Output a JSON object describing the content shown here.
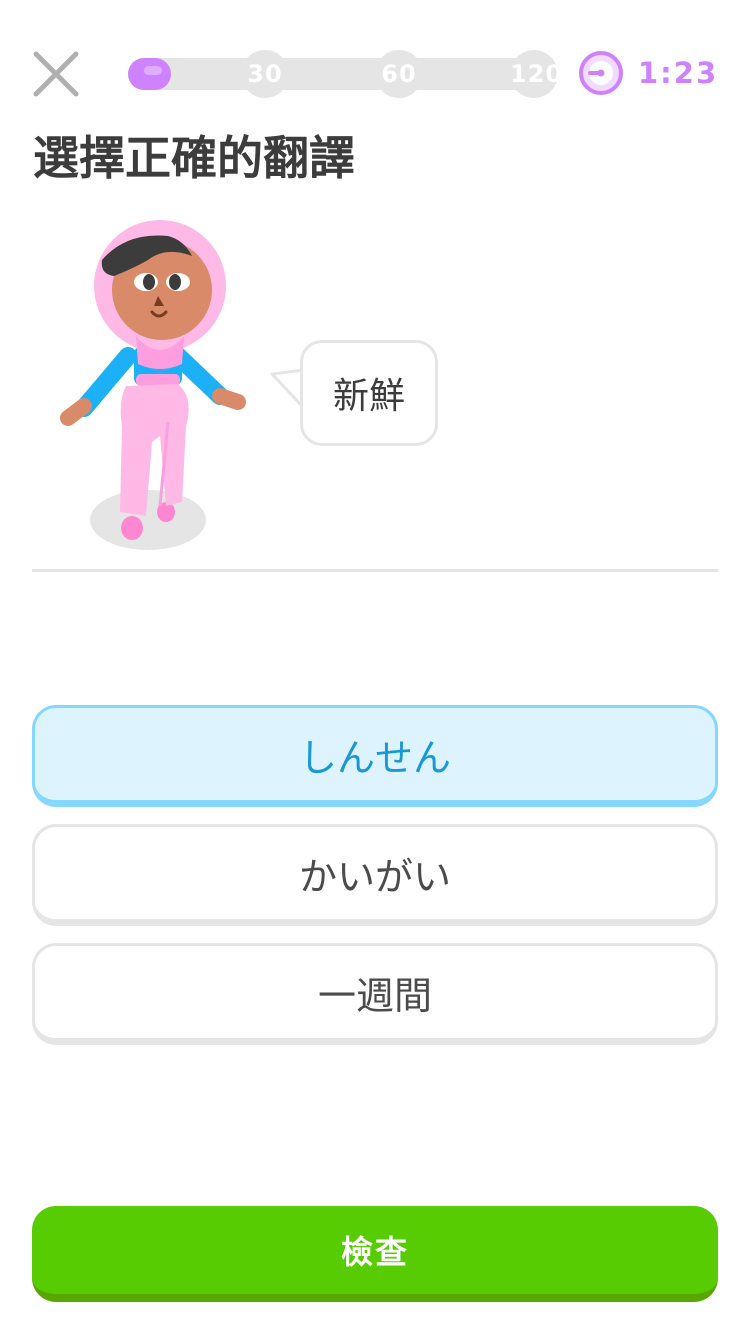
{
  "header": {
    "close_icon": "close-icon",
    "progress": {
      "fraction": 0.1,
      "milestones": [
        "30",
        "60",
        "120"
      ]
    },
    "timer": {
      "icon": "timer-icon",
      "value": "1:23"
    }
  },
  "prompt": {
    "title": "選擇正確的翻譯",
    "speech": "新鮮"
  },
  "choices": [
    {
      "label": "しんせん",
      "selected": true
    },
    {
      "label": "かいがい",
      "selected": false
    },
    {
      "label": "一週間",
      "selected": false
    }
  ],
  "footer": {
    "check_label": "檢查"
  },
  "colors": {
    "accent_purple": "#ce82ff",
    "selected_bg": "#ddf4ff",
    "selected_border": "#84d8ff",
    "selected_text": "#1899d6",
    "check_green": "#58cc02",
    "title_text": "#3c3c3c",
    "neutral_border": "#e5e5e5"
  }
}
